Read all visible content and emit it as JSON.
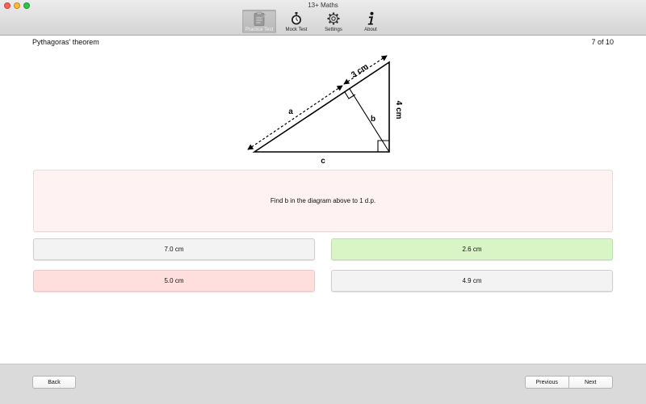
{
  "window": {
    "title": "13+ Maths"
  },
  "toolbar": {
    "items": [
      {
        "label": "Practice Test",
        "icon": "clipboard-icon",
        "active": true
      },
      {
        "label": "Mock Test",
        "icon": "stopwatch-icon",
        "active": false
      },
      {
        "label": "Settings",
        "icon": "gear-icon",
        "active": false
      },
      {
        "label": "About",
        "icon": "info-icon",
        "active": false
      }
    ]
  },
  "header": {
    "topic": "Pythagoras' theorem",
    "progress": "7 of 10"
  },
  "diagram": {
    "labels": {
      "three_cm": "3 cm",
      "four_cm": "4 cm",
      "a": "a",
      "b": "b",
      "c": "c"
    }
  },
  "question": {
    "text": "Find b in the diagram above to 1 d.p."
  },
  "answers": [
    {
      "text": "7.0 cm",
      "state": "neutral"
    },
    {
      "text": "2.6 cm",
      "state": "correct"
    },
    {
      "text": "5.0 cm",
      "state": "wrong"
    },
    {
      "text": "4.9 cm",
      "state": "neutral"
    }
  ],
  "nav": {
    "back": "Back",
    "previous": "Previous",
    "next": "Next"
  },
  "colors": {
    "correct": "#d9f5c6",
    "wrong": "#ffdede",
    "question_bg": "#fff2f2"
  }
}
